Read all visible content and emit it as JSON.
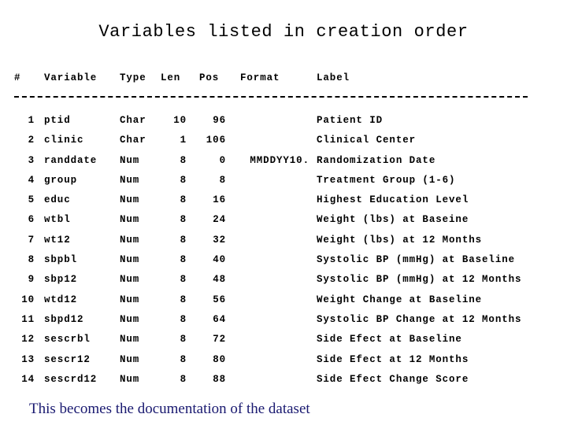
{
  "slide": {
    "title": "Variables listed in creation order",
    "caption": "This becomes the documentation of the dataset",
    "caption_color": "#191970",
    "text_color": "#000000",
    "background_color": "#ffffff"
  },
  "table": {
    "headers": {
      "num": "#",
      "variable": "Variable",
      "type": "Type",
      "len": "Len",
      "pos": "Pos",
      "format": "Format",
      "label": "Label"
    },
    "separator": "------------------------------------------------------------",
    "rows": [
      {
        "num": "1",
        "variable": "ptid",
        "type": "Char",
        "len": "10",
        "pos": "96",
        "format": "",
        "label": "Patient ID"
      },
      {
        "num": "2",
        "variable": "clinic",
        "type": "Char",
        "len": "1",
        "pos": "106",
        "format": "",
        "label": "Clinical Center"
      },
      {
        "num": "3",
        "variable": "randdate",
        "type": "Num",
        "len": "8",
        "pos": "0",
        "format": "MMDDYY10.",
        "label": "Randomization Date"
      },
      {
        "num": "4",
        "variable": "group",
        "type": "Num",
        "len": "8",
        "pos": "8",
        "format": "",
        "label": "Treatment Group (1-6)"
      },
      {
        "num": "5",
        "variable": "educ",
        "type": "Num",
        "len": "8",
        "pos": "16",
        "format": "",
        "label": "Highest Education Level"
      },
      {
        "num": "6",
        "variable": "wtbl",
        "type": "Num",
        "len": "8",
        "pos": "24",
        "format": "",
        "label": "Weight (lbs) at Baseine"
      },
      {
        "num": "7",
        "variable": "wt12",
        "type": "Num",
        "len": "8",
        "pos": "32",
        "format": "",
        "label": "Weight (lbs) at 12 Months"
      },
      {
        "num": "8",
        "variable": "sbpbl",
        "type": "Num",
        "len": "8",
        "pos": "40",
        "format": "",
        "label": "Systolic BP (mmHg) at Baseline"
      },
      {
        "num": "9",
        "variable": "sbp12",
        "type": "Num",
        "len": "8",
        "pos": "48",
        "format": "",
        "label": "Systolic BP (mmHg) at 12 Months"
      },
      {
        "num": "10",
        "variable": "wtd12",
        "type": "Num",
        "len": "8",
        "pos": "56",
        "format": "",
        "label": "Weight Change at Baseline"
      },
      {
        "num": "11",
        "variable": "sbpd12",
        "type": "Num",
        "len": "8",
        "pos": "64",
        "format": "",
        "label": "Systolic BP Change at 12 Months"
      },
      {
        "num": "12",
        "variable": "sescrbl",
        "type": "Num",
        "len": "8",
        "pos": "72",
        "format": "",
        "label": "Side Efect at Baseline"
      },
      {
        "num": "13",
        "variable": "sescr12",
        "type": "Num",
        "len": "8",
        "pos": "80",
        "format": "",
        "label": "Side Efect at 12 Months"
      },
      {
        "num": "14",
        "variable": "sescrd12",
        "type": "Num",
        "len": "8",
        "pos": "88",
        "format": "",
        "label": "Side Efect Change Score"
      }
    ]
  }
}
